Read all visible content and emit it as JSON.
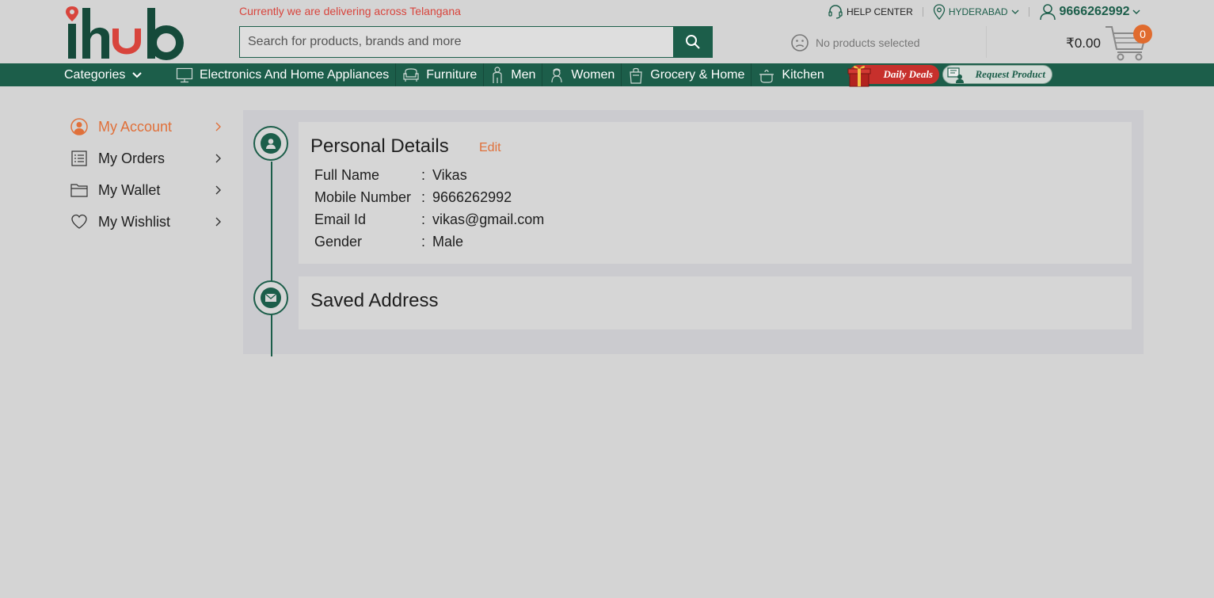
{
  "header": {
    "logo_text": "ihub",
    "delivery_note": "Currently we are delivering across Telangana",
    "search_placeholder": "Search for products, brands and more",
    "help_center": "HELP CENTER",
    "city": "HYDERABAD",
    "user_phone": "9666262992",
    "compare_status": "No products selected",
    "cart_amount": "₹0.00",
    "cart_count": "0"
  },
  "nav": {
    "categories_label": "Categories",
    "items": [
      {
        "label": "Electronics And Home Appliances",
        "icon": "monitor-icon"
      },
      {
        "label": "Furniture",
        "icon": "sofa-icon"
      },
      {
        "label": "Men",
        "icon": "man-icon"
      },
      {
        "label": "Women",
        "icon": "woman-icon"
      },
      {
        "label": "Grocery & Home",
        "icon": "grocery-bag-icon"
      },
      {
        "label": "Kitchen",
        "icon": "cooking-pot-icon"
      }
    ],
    "daily_deals": "Daily Deals",
    "request_product": "Request Product"
  },
  "sidebar": {
    "items": [
      {
        "label": "My Account",
        "icon": "user-circle-icon",
        "active": true
      },
      {
        "label": "My Orders",
        "icon": "list-icon",
        "active": false
      },
      {
        "label": "My Wallet",
        "icon": "folder-icon",
        "active": false
      },
      {
        "label": "My Wishlist",
        "icon": "heart-icon",
        "active": false
      }
    ]
  },
  "personal_details": {
    "title": "Personal Details",
    "edit_label": "Edit",
    "rows": [
      {
        "label": "Full Name",
        "value": "Vikas"
      },
      {
        "label": "Mobile Number",
        "value": "9666262992"
      },
      {
        "label": "Email Id",
        "value": "vikas@gmail.com"
      },
      {
        "label": "Gender",
        "value": "Male"
      }
    ]
  },
  "saved_address": {
    "title": "Saved Address"
  },
  "colors": {
    "brand_green": "#1c5e4a",
    "accent_orange": "#e0703a",
    "alert_red": "#d8443c"
  }
}
